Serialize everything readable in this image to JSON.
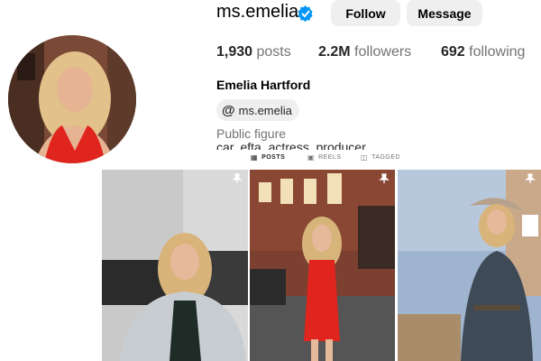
{
  "profile": {
    "username": "ms.emelia",
    "full_name": "Emelia Hartford",
    "category": "Public figure",
    "bio_partial": "car, efta, actress, producer",
    "threads_handle": "ms.emelia"
  },
  "actions": {
    "follow_label": "Follow",
    "message_label": "Message"
  },
  "stats": {
    "posts_count": "1,930",
    "posts_label": "posts",
    "followers_count": "2.2M",
    "followers_label": "followers",
    "following_count": "692",
    "following_label": "following"
  },
  "tabs": [
    {
      "label": "POSTS",
      "icon": "grid-icon",
      "active": true
    },
    {
      "label": "REELS",
      "icon": "reels-icon",
      "active": false
    },
    {
      "label": "TAGGED",
      "icon": "tagged-icon",
      "active": false
    }
  ],
  "posts": [
    {
      "pinned": true,
      "description": "woman in white denim jacket by a car"
    },
    {
      "pinned": true,
      "description": "woman in red dress at evening event"
    },
    {
      "pinned": true,
      "description": "woman in denim outfit and cowboy hat"
    }
  ],
  "colors": {
    "verified": "#0095f6",
    "button_bg": "#efefef",
    "muted_text": "#737373"
  }
}
